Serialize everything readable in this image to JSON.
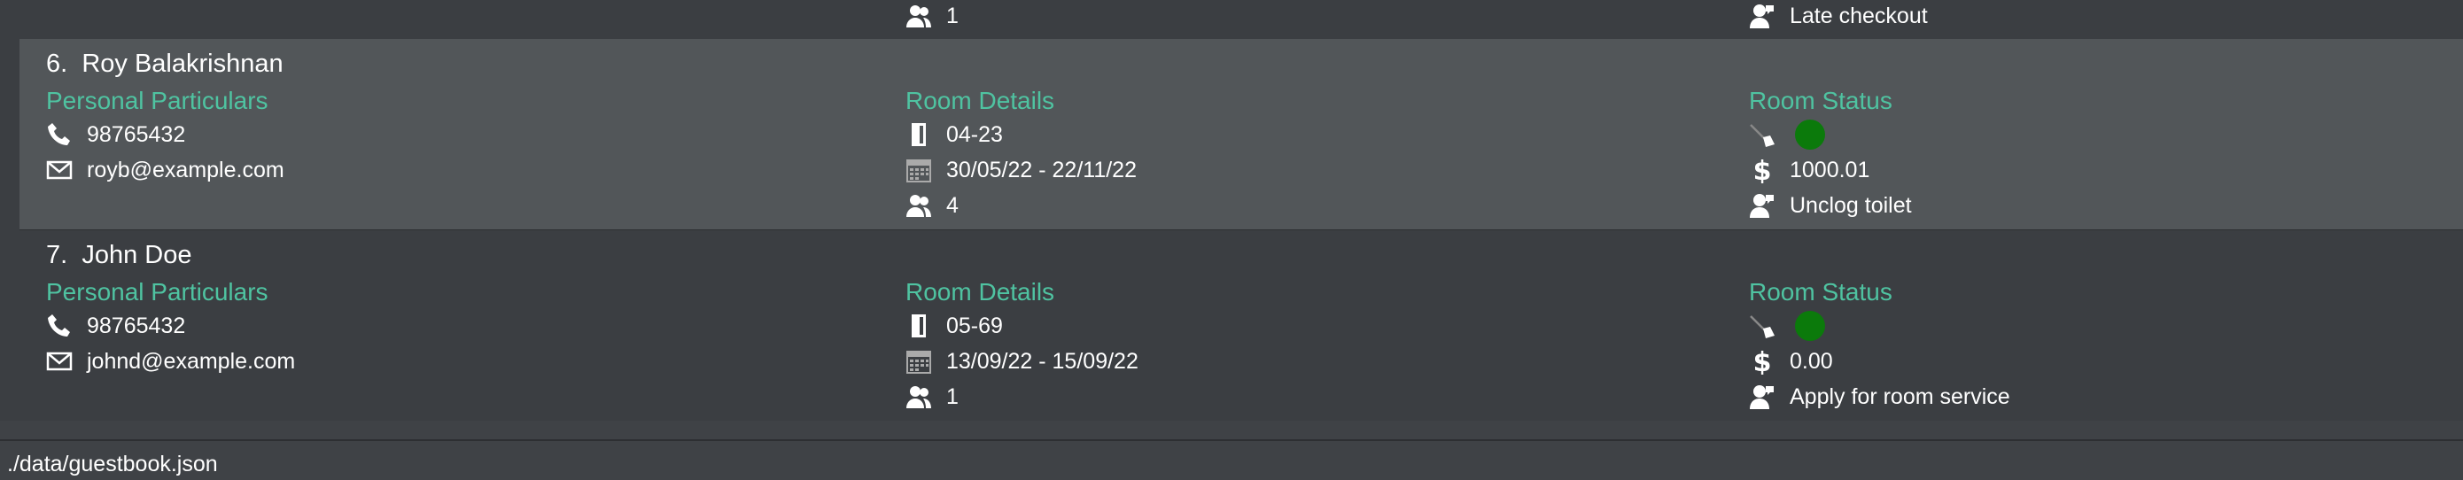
{
  "partial_row": {
    "guests": "1",
    "request": "Late checkout"
  },
  "guests": [
    {
      "index": "6.",
      "name": "Roy Balakrishnan",
      "personal_header": "Personal Particulars",
      "phone": "98765432",
      "email": "royb@example.com",
      "room_header": "Room Details",
      "room": "04-23",
      "dates": "30/05/22 - 22/11/22",
      "guest_count": "4",
      "status_header": "Room Status",
      "is_clean_color": "#0b7a0b",
      "bill": "1000.01",
      "request": "Unclog toilet",
      "selected": true
    },
    {
      "index": "7.",
      "name": "John Doe",
      "personal_header": "Personal Particulars",
      "phone": "98765432",
      "email": "johnd@example.com",
      "room_header": "Room Details",
      "room": "05-69",
      "dates": "13/09/22 - 15/09/22",
      "guest_count": "1",
      "status_header": "Room Status",
      "is_clean_color": "#0b7a0b",
      "bill": "0.00",
      "request": "Apply for room service",
      "selected": false
    }
  ],
  "status_bar": {
    "file_path": "./data/guestbook.json"
  },
  "colors": {
    "accent": "#4fc3a1",
    "selected_row": "#525659",
    "row": "#3b3e42",
    "clean_dot": "#0b7a0b"
  },
  "icons": [
    "phone-icon",
    "mail-icon",
    "door-icon",
    "calendar-icon",
    "guests-icon",
    "broom-icon",
    "dollar-icon",
    "request-icon"
  ]
}
